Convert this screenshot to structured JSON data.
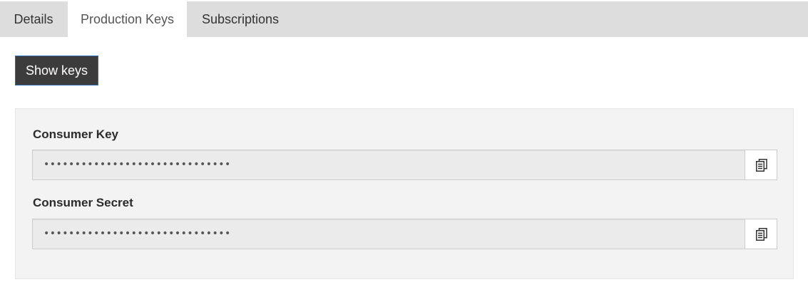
{
  "tabs": [
    {
      "label": "Details",
      "active": false
    },
    {
      "label": "Production Keys",
      "active": true
    },
    {
      "label": "Subscriptions",
      "active": false
    }
  ],
  "actions": {
    "show_keys_label": "Show keys"
  },
  "fields": {
    "consumer_key": {
      "label": "Consumer Key",
      "value": "••••••••••••••••••••••••••••••",
      "copy_icon": "clipboard-icon"
    },
    "consumer_secret": {
      "label": "Consumer Secret",
      "value": "••••••••••••••••••••••••••••••",
      "copy_icon": "clipboard-icon"
    }
  },
  "colors": {
    "tab_bar": "#dddddd",
    "active_tab": "#ffffff",
    "button_bg": "#3c3c3c",
    "button_border": "#2f6db1",
    "panel_bg": "#f3f3f3",
    "input_bg": "#ebebeb"
  }
}
